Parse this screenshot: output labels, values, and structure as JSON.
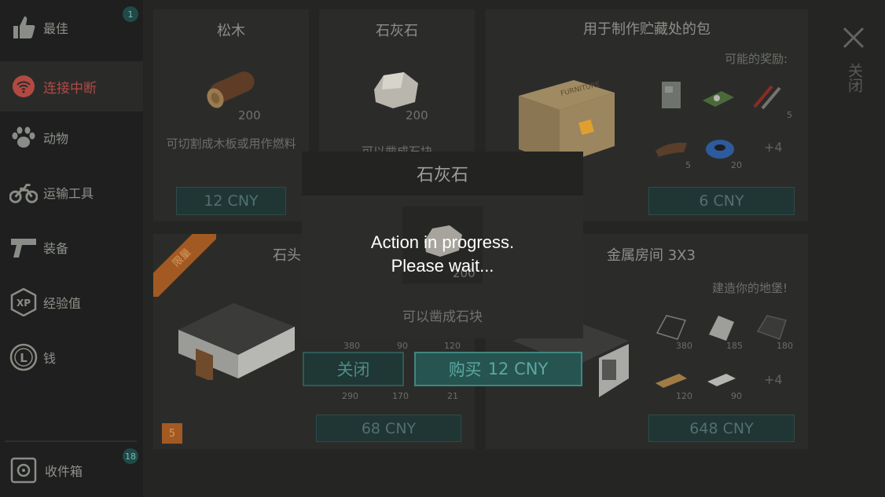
{
  "sidebar": {
    "items": [
      {
        "label": "最佳",
        "icon": "thumbs-up-icon",
        "badge": "1"
      },
      {
        "label": "连接中断",
        "icon": "wifi-disconnected-icon",
        "active": true
      },
      {
        "label": "动物",
        "icon": "paw-icon"
      },
      {
        "label": "运输工具",
        "icon": "motorcycle-icon"
      },
      {
        "label": "装备",
        "icon": "pistol-icon"
      },
      {
        "label": "经验值",
        "icon": "xp-icon"
      },
      {
        "label": "钱",
        "icon": "coin-icon"
      }
    ],
    "inbox": {
      "label": "收件箱",
      "icon": "inbox-box-icon",
      "badge": "18"
    }
  },
  "cards": {
    "pine": {
      "title": "松木",
      "qty": "200",
      "desc": "可切割成木板或用作燃料",
      "price": "12 CNY"
    },
    "limestone": {
      "title": "石灰石",
      "qty": "200",
      "desc": "可以凿成石块",
      "price": ""
    },
    "stash_bag": {
      "title": "用于制作贮藏处的包",
      "rewards_label": "可能的奖励:",
      "crate_text": "FURNITURE",
      "reward_qty": [
        "5",
        "5",
        "20"
      ],
      "more": "+4",
      "price": "6 CNY"
    },
    "stone_room": {
      "title": "石头",
      "ribbon": "限量",
      "level": "5",
      "qtys_top": [
        "380",
        "90",
        "120"
      ],
      "qtys_bottom": [
        "290",
        "170",
        "21"
      ],
      "price": "68 CNY"
    },
    "metal_room": {
      "title": "金属房间 3X3",
      "subtitle": "建造你的地堡!",
      "qtys_top": [
        "380",
        "185",
        "180"
      ],
      "qtys_bottom": [
        "120",
        "90"
      ],
      "more": "+4",
      "price": "648 CNY"
    }
  },
  "close": {
    "vertical_label": "关闭"
  },
  "modal": {
    "title": "石灰石",
    "item_qty": "200",
    "desc": "可以凿成石块",
    "progress_line1": "Action in progress.",
    "progress_line2": "Please wait...",
    "close_label": "关闭",
    "buy_label": "购买",
    "buy_price": "12 CNY"
  },
  "colors": {
    "accent_teal": "#3f8780",
    "alert_red": "#b24a42",
    "badge_teal": "#1f4a47"
  }
}
